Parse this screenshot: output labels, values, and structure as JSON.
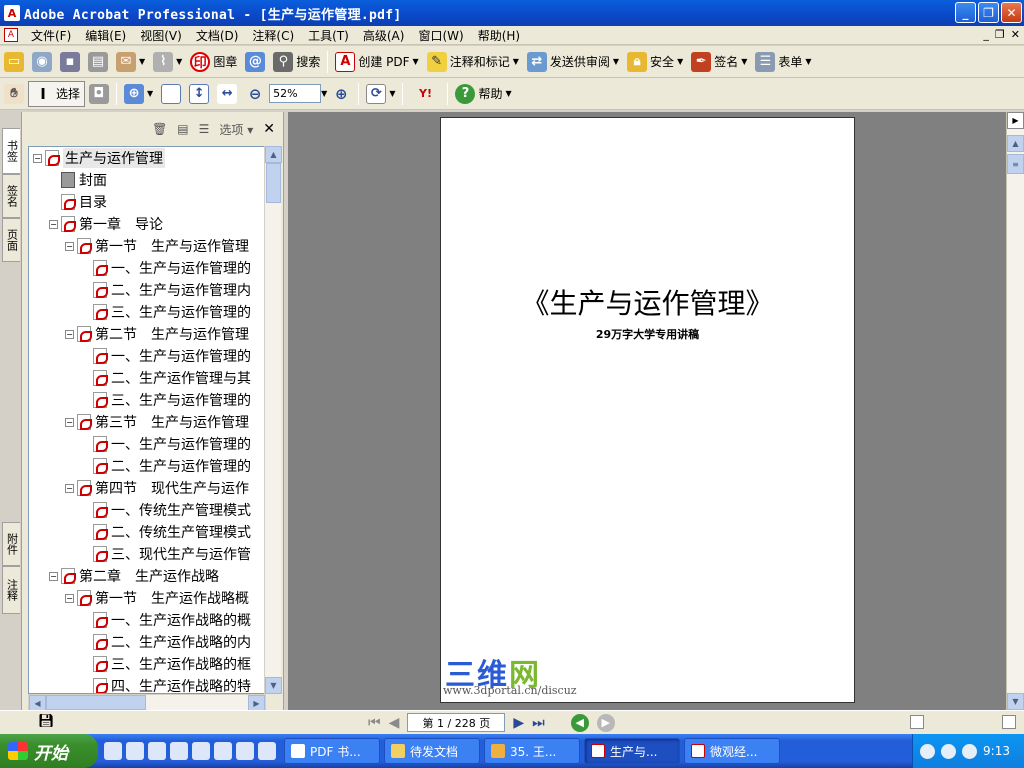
{
  "window": {
    "title": "Adobe Acrobat Professional - [生产与运作管理.pdf]"
  },
  "menu": [
    "文件(F)",
    "编辑(E)",
    "视图(V)",
    "文档(D)",
    "注释(C)",
    "工具(T)",
    "高级(A)",
    "窗口(W)",
    "帮助(H)"
  ],
  "toolbar1": {
    "stamp": "图章",
    "search": "搜索",
    "create_pdf": "创建 PDF",
    "comment": "注释和标记",
    "send_review": "发送供审阅",
    "security": "安全",
    "sign": "签名",
    "forms": "表单"
  },
  "toolbar2": {
    "select": "选择",
    "zoom": "52%",
    "help": "帮助"
  },
  "sidetabs": {
    "bookmarks": "书签",
    "signatures": "签名",
    "pages": "页面",
    "attachments": "附件",
    "comments": "注释"
  },
  "panel": {
    "options": "选项"
  },
  "bookmarks": [
    {
      "level": 0,
      "expander": "⊟",
      "icon": "pdf",
      "label": "生产与运作管理"
    },
    {
      "level": 1,
      "expander": "",
      "icon": "page",
      "label": "封面"
    },
    {
      "level": 1,
      "expander": "",
      "icon": "pdf",
      "label": "目录"
    },
    {
      "level": 1,
      "expander": "⊟",
      "icon": "pdf",
      "label": "第一章　导论"
    },
    {
      "level": 2,
      "expander": "⊟",
      "icon": "pdf",
      "label": "第一节　生产与运作管理"
    },
    {
      "level": 3,
      "expander": "",
      "icon": "pdf",
      "label": "一、生产与运作管理的"
    },
    {
      "level": 3,
      "expander": "",
      "icon": "pdf",
      "label": "二、生产与运作管理内"
    },
    {
      "level": 3,
      "expander": "",
      "icon": "pdf",
      "label": "三、生产与运作管理的"
    },
    {
      "level": 2,
      "expander": "⊟",
      "icon": "pdf",
      "label": "第二节　生产与运作管理"
    },
    {
      "level": 3,
      "expander": "",
      "icon": "pdf",
      "label": "一、生产与运作管理的"
    },
    {
      "level": 3,
      "expander": "",
      "icon": "pdf",
      "label": "二、生产运作管理与其"
    },
    {
      "level": 3,
      "expander": "",
      "icon": "pdf",
      "label": "三、生产与运作管理的"
    },
    {
      "level": 2,
      "expander": "⊟",
      "icon": "pdf",
      "label": "第三节　生产与运作管理"
    },
    {
      "level": 3,
      "expander": "",
      "icon": "pdf",
      "label": "一、生产与运作管理的"
    },
    {
      "level": 3,
      "expander": "",
      "icon": "pdf",
      "label": "二、生产与运作管理的"
    },
    {
      "level": 2,
      "expander": "⊟",
      "icon": "pdf",
      "label": "第四节　现代生产与运作"
    },
    {
      "level": 3,
      "expander": "",
      "icon": "pdf",
      "label": "一、传统生产管理模式"
    },
    {
      "level": 3,
      "expander": "",
      "icon": "pdf",
      "label": "二、传统生产管理模式"
    },
    {
      "level": 3,
      "expander": "",
      "icon": "pdf",
      "label": "三、现代生产与运作管"
    },
    {
      "level": 1,
      "expander": "⊟",
      "icon": "pdf",
      "label": "第二章　生产运作战略"
    },
    {
      "level": 2,
      "expander": "⊟",
      "icon": "pdf",
      "label": "第一节　生产运作战略概"
    },
    {
      "level": 3,
      "expander": "",
      "icon": "pdf",
      "label": "一、生产运作战略的概"
    },
    {
      "level": 3,
      "expander": "",
      "icon": "pdf",
      "label": "二、生产运作战略的内"
    },
    {
      "level": 3,
      "expander": "",
      "icon": "pdf",
      "label": "三、生产运作战略的框"
    },
    {
      "level": 3,
      "expander": "",
      "icon": "pdf",
      "label": "四、生产运作战略的特"
    }
  ],
  "document": {
    "title": "《生产与运作管理》",
    "subtitle": "29万字大学专用讲稿",
    "watermark_brand_a": "三维",
    "watermark_brand_b": "网",
    "watermark_url": "www.3dportal.cn/discuz"
  },
  "status": {
    "page_indicator": "第 1 / 228 页"
  },
  "taskbar": {
    "start": "开始",
    "tasks": [
      {
        "label": "PDF 书..."
      },
      {
        "label": "待发文档"
      },
      {
        "label": "35. 王..."
      },
      {
        "label": "生产与..."
      },
      {
        "label": "微观经..."
      }
    ],
    "clock": "9:13"
  }
}
